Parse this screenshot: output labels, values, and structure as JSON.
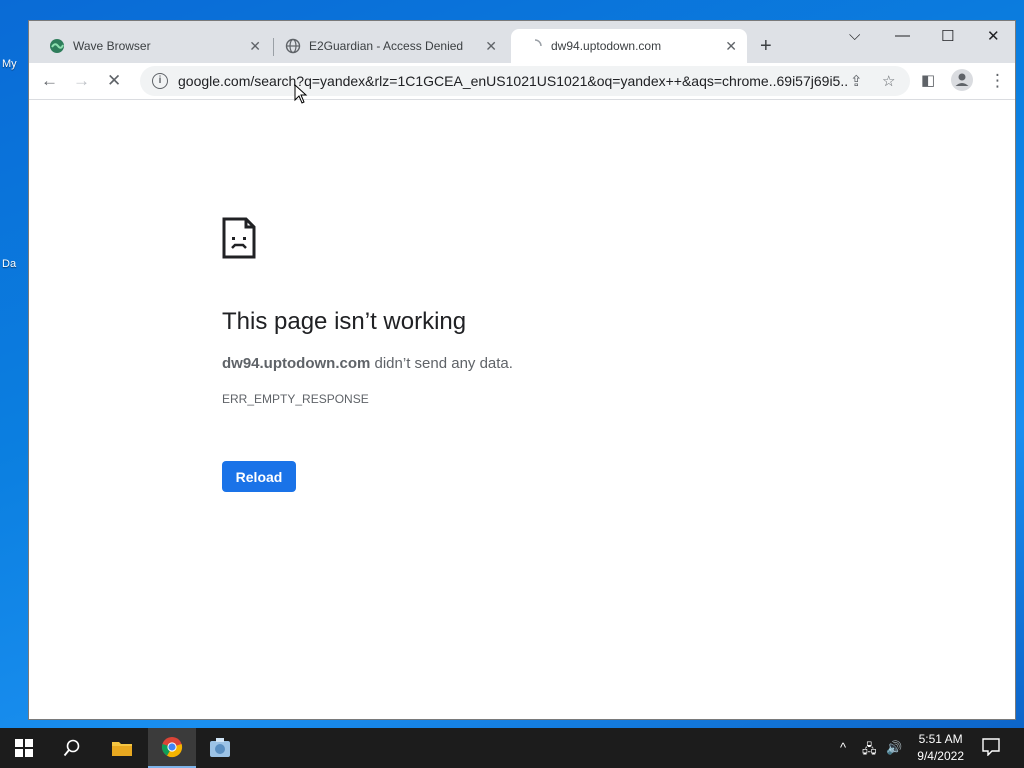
{
  "desktop": {
    "labels": [
      "My",
      "Da"
    ]
  },
  "browser": {
    "tabs": [
      {
        "title": "Wave Browser",
        "icon": "wave-browser-icon"
      },
      {
        "title": "E2Guardian - Access Denied",
        "icon": "globe-icon"
      },
      {
        "title": "dw94.uptodown.com",
        "icon": "loading-icon",
        "active": true
      }
    ],
    "new_tab_label": "+",
    "address": "google.com/search?q=yandex&rlz=1C1GCEA_enUS1021US1021&oq=yandex++&aqs=chrome..69i57j69i5..."
  },
  "error_page": {
    "title": "This page isn’t working",
    "host": "dw94.uptodown.com",
    "message": " didn’t send any data.",
    "code": "ERR_EMPTY_RESPONSE",
    "reload_label": "Reload"
  },
  "taskbar": {
    "time": "5:51 AM",
    "date": "9/4/2022"
  },
  "colors": {
    "accent": "#1a73e8",
    "tabstrip": "#dee1e6",
    "taskbar": "#1c1c1c"
  }
}
